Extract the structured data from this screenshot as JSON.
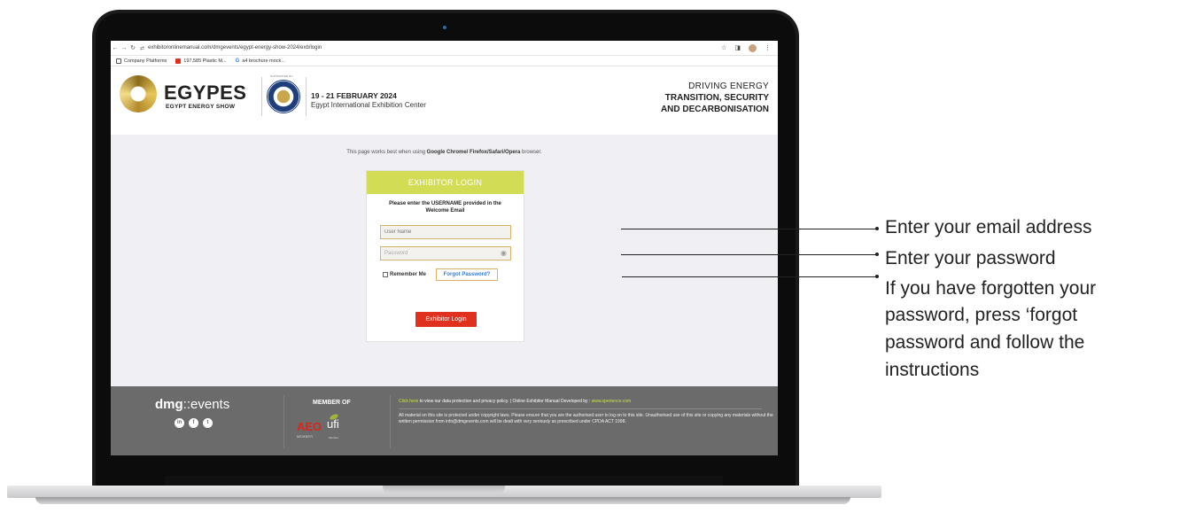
{
  "browser": {
    "url": "exhibitoronlinemanual.com/dmgevents/egypt-energy-show-2024/exb/login",
    "bookmarks": [
      "Company Platforms",
      "197,585 Plastic M...",
      "a4 brochure mock..."
    ]
  },
  "header": {
    "logo_title": "EGYPES",
    "logo_subtitle": "EGYPT ENERGY SHOW",
    "seal_label": "SUPPORTED BY",
    "date": "19 - 21 FEBRUARY 2024",
    "venue": "Egypt International Exhibition Center",
    "tagline_1": "DRIVING ENERGY",
    "tagline_2": "TRANSITION, SECURITY",
    "tagline_3": "AND DECARBONISATION"
  },
  "notice": {
    "prefix": "This page works best when using ",
    "browsers": "Google Chrome/ Firefox/Safari/Opera",
    "suffix": " browser."
  },
  "login": {
    "title": "EXHIBITOR LOGIN",
    "message": "Please enter the USERNAME provided in the Welcome Email",
    "username_placeholder": "User Name",
    "password_placeholder": "Password",
    "remember_label": "Remember Me",
    "forgot_label": "Forgot Password?",
    "submit_label": "Exhibitor Login"
  },
  "footer": {
    "brand_prefix": "dmg",
    "brand_suffix": "::events",
    "member_of": "MEMBER OF",
    "aeo": "AEO",
    "aeo_sub": "MEMBER",
    "ufi": "ufi",
    "ufi_sub": "Member",
    "link_text": "Click here",
    "link_rest": " to view our data protection and privacy policy. | Online Exhibitor Manual Developed by : ",
    "dev_link": "www.xperience.com",
    "legal": "All material on this site is protected under copyright laws. Please ensure that you are the authorised user to log on to this site. Unauthorised use of this site or copying any materials without the written permission from info@dmgevents.com will be dealt with very seriously as prescribed under CPDA ACT 1998."
  },
  "annotations": {
    "email": "Enter your email address",
    "password": "Enter your password",
    "forgot_1": "If you have forgotten your",
    "forgot_2": "password, press ‘forgot",
    "forgot_3": "password and follow the",
    "forgot_4": "instructions"
  }
}
